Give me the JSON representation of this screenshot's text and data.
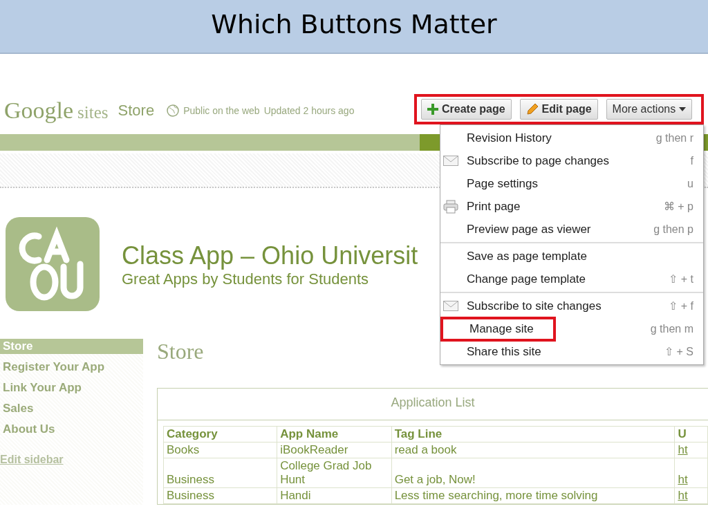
{
  "slide_title": "Which Buttons Matter",
  "header": {
    "logo_word": "Google",
    "logo_suffix": "sites",
    "site_name": "Store",
    "visibility": "Public on the web",
    "updated": "Updated 2 hours ago"
  },
  "toolbar": {
    "highlighted": true,
    "buttons": [
      {
        "label": "Create page",
        "kind": "plus"
      },
      {
        "label": "Edit page",
        "kind": "pencil"
      },
      {
        "label": "More actions",
        "kind": "dropdown"
      }
    ]
  },
  "menu": {
    "groups": [
      [
        {
          "label": "Revision History",
          "shortcut": "g then r",
          "kind": "plain",
          "highlighted": false
        },
        {
          "label": "Subscribe to page changes",
          "shortcut": "f",
          "kind": "mail",
          "highlighted": false
        },
        {
          "label": "Page settings",
          "shortcut": "u",
          "kind": "plain",
          "highlighted": false
        },
        {
          "label": "Print page",
          "shortcut": "⌘ + p",
          "kind": "print",
          "highlighted": false
        },
        {
          "label": "Preview page as viewer",
          "shortcut": "g then p",
          "kind": "plain",
          "highlighted": false
        }
      ],
      [
        {
          "label": "Save as page template",
          "kind": "plain",
          "highlighted": false
        },
        {
          "label": "Change page template",
          "shortcut": "⇧ + t",
          "kind": "plain",
          "highlighted": false
        }
      ],
      [
        {
          "label": "Subscribe to site changes",
          "shortcut": "⇧ + f",
          "kind": "mail",
          "highlighted": false
        },
        {
          "label": "Manage site",
          "shortcut": "g then m",
          "kind": "plain",
          "highlighted": true
        },
        {
          "label": "Share this site",
          "shortcut": "⇧ + S",
          "kind": "plain",
          "highlighted": false
        }
      ]
    ]
  },
  "site": {
    "title": "Class App – Ohio Universit",
    "tagline": "Great Apps by Students for Students"
  },
  "sidebar": {
    "items": [
      {
        "label": "Store",
        "selected": true
      },
      {
        "label": "Register Your App",
        "selected": false
      },
      {
        "label": "Link Your App",
        "selected": false
      },
      {
        "label": "Sales",
        "selected": false
      },
      {
        "label": "About Us",
        "selected": false
      }
    ],
    "edit_link": "Edit sidebar"
  },
  "page_title": "Store",
  "table": {
    "caption": "Application List",
    "columns": [
      "Category",
      "App Name",
      "Tag Line",
      "U"
    ],
    "rows": [
      [
        "Books",
        "iBookReader",
        "read a book",
        "ht"
      ],
      [
        "Business",
        "College Grad Job Hunt",
        "Get a job, Now!",
        "ht"
      ],
      [
        "Business",
        "Handi",
        "Less time searching, more time solving",
        "ht"
      ]
    ]
  }
}
